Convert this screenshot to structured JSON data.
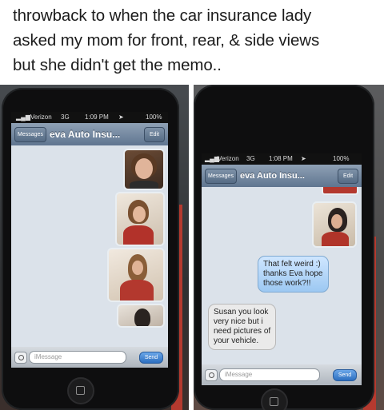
{
  "caption": {
    "lines": [
      "throwback to when the car insurance lady",
      "asked my mom for front, rear, & side views",
      "but she didn't get the memo.."
    ]
  },
  "phone_left": {
    "status": {
      "carrier": "Verizon",
      "network": "3G",
      "time": "1:09 PM",
      "battery": "100%"
    },
    "nav": {
      "back_label": "Messages",
      "title": "eva Auto Insu...",
      "edit_label": "Edit"
    },
    "input": {
      "placeholder": "iMessage",
      "send_label": "Send"
    }
  },
  "phone_right": {
    "status": {
      "carrier": "Verizon",
      "network": "3G",
      "time": "1:08 PM",
      "battery": "100%"
    },
    "nav": {
      "back_label": "Messages",
      "title": "eva Auto Insu...",
      "edit_label": "Edit"
    },
    "messages": [
      {
        "direction": "outgoing",
        "lines": [
          "That felt weird :)",
          "thanks Eva hope",
          "those work?!!"
        ]
      },
      {
        "direction": "incoming",
        "lines": [
          "Susan you look",
          "very nice but i",
          "need pictures of",
          "your vehicle."
        ]
      }
    ],
    "input": {
      "placeholder": "iMessage",
      "send_label": "Send"
    }
  },
  "colors": {
    "bubble_outgoing": "#9cc8f2",
    "bubble_incoming": "#eaeaea",
    "navbar": "#5f7590",
    "case_red": "#b53a2f"
  }
}
